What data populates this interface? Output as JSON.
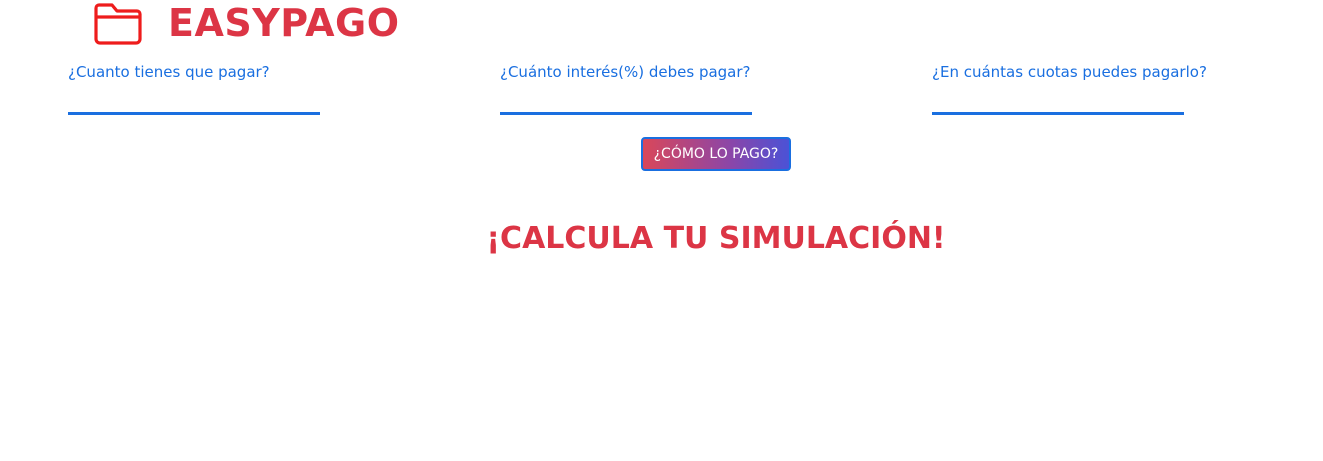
{
  "brand": {
    "title": "EASYPAGO",
    "icon": "folder-icon",
    "color": "#dc3545"
  },
  "form": {
    "fields": [
      {
        "label": "¿Cuanto tienes que pagar?",
        "value": "",
        "placeholder": ""
      },
      {
        "label": "¿Cuánto interés(%) debes pagar?",
        "value": "",
        "placeholder": ""
      },
      {
        "label": "¿En cuántas cuotas puedes pagarlo?",
        "value": "",
        "placeholder": ""
      }
    ],
    "accent_color": "#1a6fe0",
    "submit_label": "¿CÓMO LO PAGO?"
  },
  "result": {
    "heading": "¡CALCULA TU SIMULACIÓN!"
  }
}
